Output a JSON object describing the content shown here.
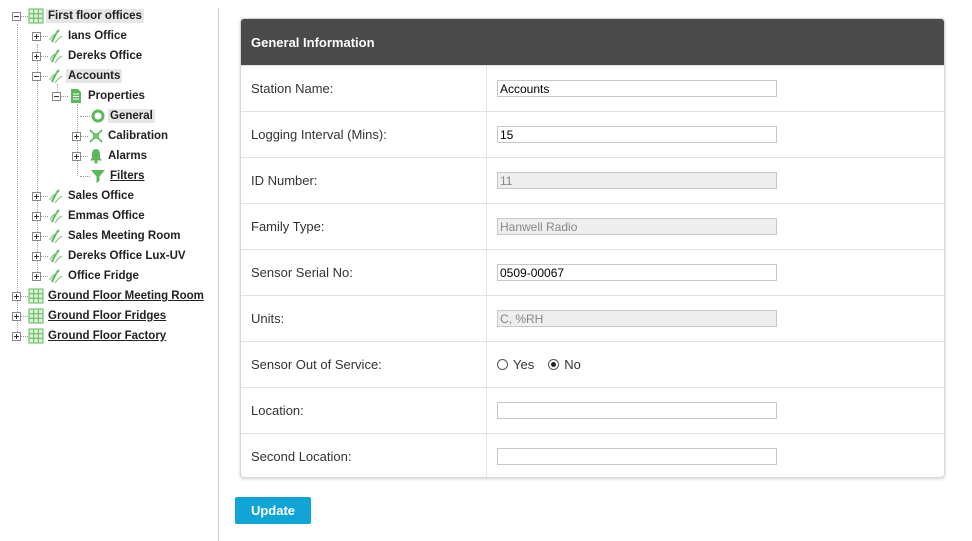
{
  "tree": {
    "root": {
      "label": "First floor offices"
    },
    "items": {
      "ians_office": "Ians Office",
      "dereks_office": "Dereks Office",
      "accounts": "Accounts",
      "properties": "Properties",
      "general": "General",
      "calibration": "Calibration",
      "alarms": "Alarms",
      "filters": "Filters",
      "sales_office": "Sales Office",
      "emmas_office": "Emmas Office",
      "sales_meeting_room": "Sales Meeting Room",
      "dereks_office_lux_uv": "Dereks Office Lux-UV",
      "office_fridge": "Office Fridge"
    },
    "roots": {
      "ground_floor_meeting_room": "Ground Floor Meeting Room",
      "ground_floor_fridges": "Ground Floor Fridges",
      "ground_floor_factory": "Ground Floor Factory"
    }
  },
  "panel": {
    "title": "General Information",
    "fields": {
      "station_name": {
        "label": "Station Name:",
        "value": "Accounts"
      },
      "logging_interval": {
        "label": "Logging Interval (Mins):",
        "value": "15"
      },
      "id_number": {
        "label": "ID Number:",
        "value": "11"
      },
      "family_type": {
        "label": "Family Type:",
        "value": "Hanwell Radio"
      },
      "sensor_serial": {
        "label": "Sensor Serial No:",
        "value": "0509-00067"
      },
      "units": {
        "label": "Units:",
        "value": "C, %RH"
      },
      "out_of_service": {
        "label": "Sensor Out of Service:",
        "yes": "Yes",
        "no": "No",
        "selected": "No"
      },
      "location": {
        "label": "Location:",
        "value": ""
      },
      "second_location": {
        "label": "Second Location:",
        "value": ""
      }
    }
  },
  "update_label": "Update",
  "colors": {
    "header_bg": "#4a4a4a",
    "button_bg": "#11a4d6",
    "tree_icon_green": "#5cb85c"
  }
}
